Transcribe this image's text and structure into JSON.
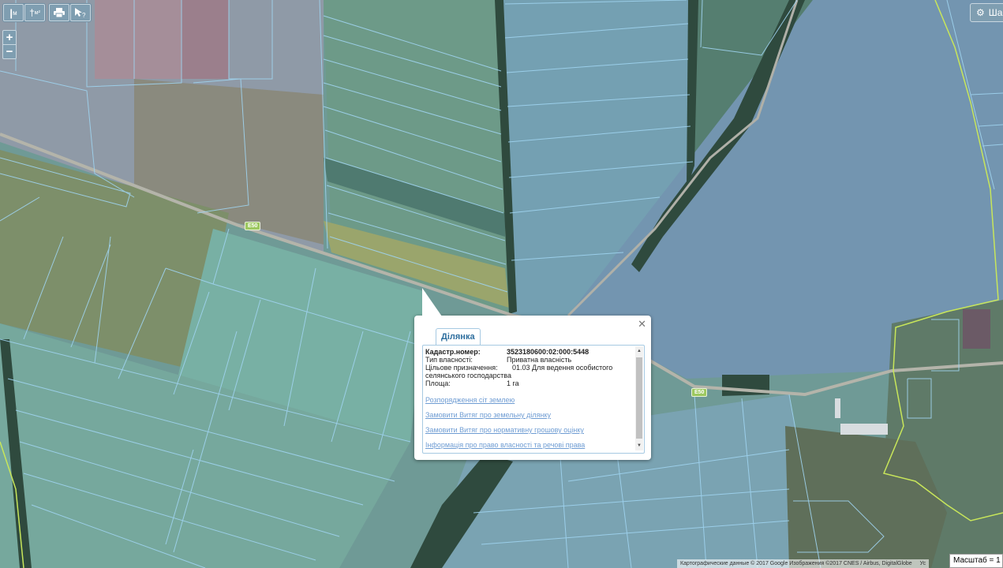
{
  "toolbar": {
    "ruler_label": "м",
    "area_label": "м²",
    "zoom_in": "+",
    "zoom_out": "−",
    "layers_button": "Шар"
  },
  "map": {
    "road_label_1": "E50",
    "road_label_2": "E50"
  },
  "popup": {
    "tab_title": "Ділянка",
    "fields": [
      {
        "label": "Кадастр.номер:",
        "value": "3523180600:02:000:5448"
      },
      {
        "label": "Тип власності:",
        "value": "Приватна власність"
      },
      {
        "label": "Цільове призначення:",
        "value": "01.03 Для ведення особистого"
      },
      {
        "label": "",
        "value": "селянського господарства"
      },
      {
        "label": "Площа:",
        "value": "1 га"
      }
    ],
    "links": [
      "Розпорядження сіт землею",
      "Замовити Витяг про земельну ділянку",
      "Замовити Витяг про нормативну грошову оцінку",
      "Інформація про право власності та речові права"
    ]
  },
  "footer": {
    "attribution": "Картографические данные © 2017 Google Изображения ©2017 CNES / Airbus, DigitalGlobe",
    "attribution_tail": "Ус",
    "scale": "Масштаб = 1 :"
  },
  "colors": {
    "parcel_stroke": "#9fd3ef",
    "boundary": "#c8e65a",
    "field_base": "#6f9a96",
    "forest": "#2f4a3e"
  }
}
